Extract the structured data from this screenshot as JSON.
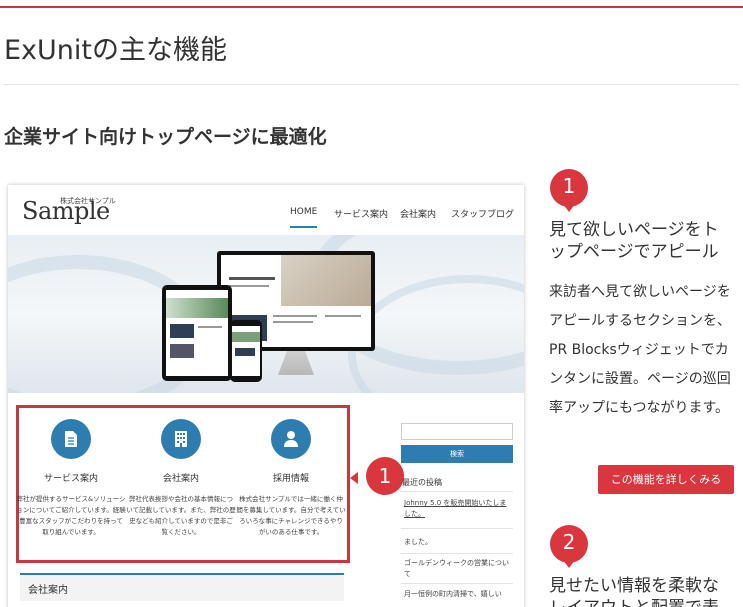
{
  "page": {
    "title": "ExUnitの主な機能",
    "subtitle": "企業サイト向けトップページに最適化"
  },
  "preview": {
    "logo_small": "株式会社サンプル",
    "logo": "Sample",
    "nav": [
      "HOME",
      "サービス案内",
      "会社案内",
      "スタッフブログ"
    ],
    "services": [
      {
        "icon": "document-icon",
        "title": "サービス案内",
        "text": "弊社が提供するサービス&ソリューションについてご紹介しています。経験豊富なスタッフがこだわりを持って取り組んでいます。"
      },
      {
        "icon": "building-icon",
        "title": "会社案内",
        "text": "弊社代表挨拶や会社の基本情報について記載しています。また、弊社の歴史なども紹介していますので是非ご覧ください。"
      },
      {
        "icon": "person-icon",
        "title": "採用情報",
        "text": "株式会社サンプルでは一緒に働く仲間を募集しています。自分で考えていろいろな事にチャレンジできるやりがいのある仕事です。"
      }
    ],
    "search_button": "検索",
    "recent_posts_heading": "最近の投稿",
    "recent_posts": [
      "Johnny 5.0 を販売開始いたしました。",
      "ました。",
      "ゴールデンウィークの営業について",
      "月一恒例の町内清掃で、嬉しい"
    ],
    "company_heading": "会社案内",
    "callout_number": "1"
  },
  "features": [
    {
      "number": "1",
      "heading": "見て欲しいページをトップページでアピール",
      "body": "来訪者へ見て欲しいページをアピールするセクションを、PR Blocksウィジェットでカンタンに設置。ページの巡回率アップにもつながります。",
      "button": "この機能を詳しくみる"
    },
    {
      "number": "2",
      "heading": "見せたい情報を柔軟なレイアウトと配置で表"
    }
  ],
  "colors": {
    "accent_red": "#d9363e",
    "accent_blue": "#2e7db0"
  }
}
